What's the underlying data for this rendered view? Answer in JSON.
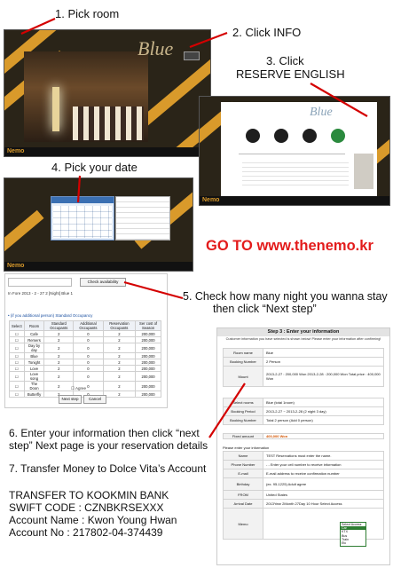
{
  "steps": {
    "s1": "1. Pick room",
    "s2": "2. Click INFO",
    "s3_l1": "3. Click",
    "s3_l2": "RESERVE ENGLISH",
    "s4": "4. Pick your date",
    "s5_l1": "5. Check how many night you wanna stay",
    "s5_l2": "then click “Next step”",
    "s6_l1": "6. Enter your information then click “next",
    "s6_l2": "step” Next page is your reservation details",
    "s7": "7. Transfer Money to Dolce Vita’s Account"
  },
  "goto": "GO TO www.thenemo.kr",
  "bank": {
    "transfer": "TRANSFER TO KOOKMIN BANK",
    "swift": "SWIFT CODE : CZNBKRSEXXX",
    "name": "Account Name : Kwon Young Hwan",
    "number": "Account No : 217802-04-374439"
  },
  "shot1": {
    "logo": "Blue",
    "brand": "Nemo"
  },
  "shot2": {
    "logo": "Blue",
    "brand": "Nemo"
  },
  "shot3": {
    "brand": "Nemo"
  },
  "shot4": {
    "check_btn": "Check availability",
    "date_room": "In Fore 2013 - 2 - 27 2 [Night] Blue 1",
    "guests_title": "• (if you additional person) Standard Occupancy",
    "headers": [
      "Select",
      "Room",
      "Standard Occupants",
      "Additional Occupants",
      "Reservation Occupants",
      "Ser cost of Season"
    ],
    "rows": [
      [
        "Cafe",
        "2",
        "0",
        "2",
        "200,000"
      ],
      [
        "Remers",
        "2",
        "0",
        "2",
        "200,000"
      ],
      [
        "Day by day",
        "2",
        "0",
        "2",
        "200,000"
      ],
      [
        "Blue",
        "2",
        "0",
        "2",
        "200,000"
      ],
      [
        "Tonight",
        "2",
        "0",
        "2",
        "200,000"
      ],
      [
        "Love",
        "2",
        "0",
        "2",
        "200,000"
      ],
      [
        "Love song",
        "2",
        "0",
        "2",
        "200,000"
      ],
      [
        "The Doon",
        "2",
        "0",
        "2",
        "200,000"
      ],
      [
        "Butterfly",
        "2",
        "0",
        "2",
        "200,000"
      ]
    ],
    "agree": "Agree",
    "next": "Next step",
    "cancel": "Cancel"
  },
  "shot5": {
    "title": "Step 3 : Enter your information",
    "subtitle": "Customer information you have selected is shown below! Please enter your information after confirming!",
    "summary": [
      {
        "k": "Room name",
        "v": "Blue"
      },
      {
        "k": "Booking Number",
        "v": "2 Person"
      },
      {
        "k": "Mount",
        "v": "2013-2-27 : 200,000 Won   2013-2-28 : 200,000 Won   Total price : 400,000 Won"
      }
    ],
    "booking": [
      {
        "k": "Select rooms",
        "v": "Blue (total 1room)"
      },
      {
        "k": "Booking Period",
        "v": "2013-2-27 ~ 2013-2-28 (2 night 3 day)"
      },
      {
        "k": "Booking Number",
        "v": "Total 2 person (Add 0 person)"
      }
    ],
    "fixed": {
      "k": "Fixed amount",
      "v": "400,000 Won"
    },
    "enter_title": "Please enter your information",
    "form": [
      {
        "k": "Name",
        "v": "TEST   Reservations must enter the name."
      },
      {
        "k": "Phone Number",
        "v": "-  -   Enter your cell number to receive information"
      },
      {
        "k": "E-mail",
        "v": "E-mail address to receive confirmation number"
      },
      {
        "k": "Birthday",
        "v": "(ex. 95-1225)  Adult agree"
      },
      {
        "k": "FROM",
        "v": "United States"
      },
      {
        "k": "Arrival Date",
        "v": "2013Year 2Month 27Day  10 Hour  Select Access"
      },
      {
        "k": "Memo",
        "v": ""
      }
    ],
    "dropdown": [
      "Select Access",
      "Car",
      "KTX",
      "Bus",
      "Train",
      "Etc"
    ]
  }
}
